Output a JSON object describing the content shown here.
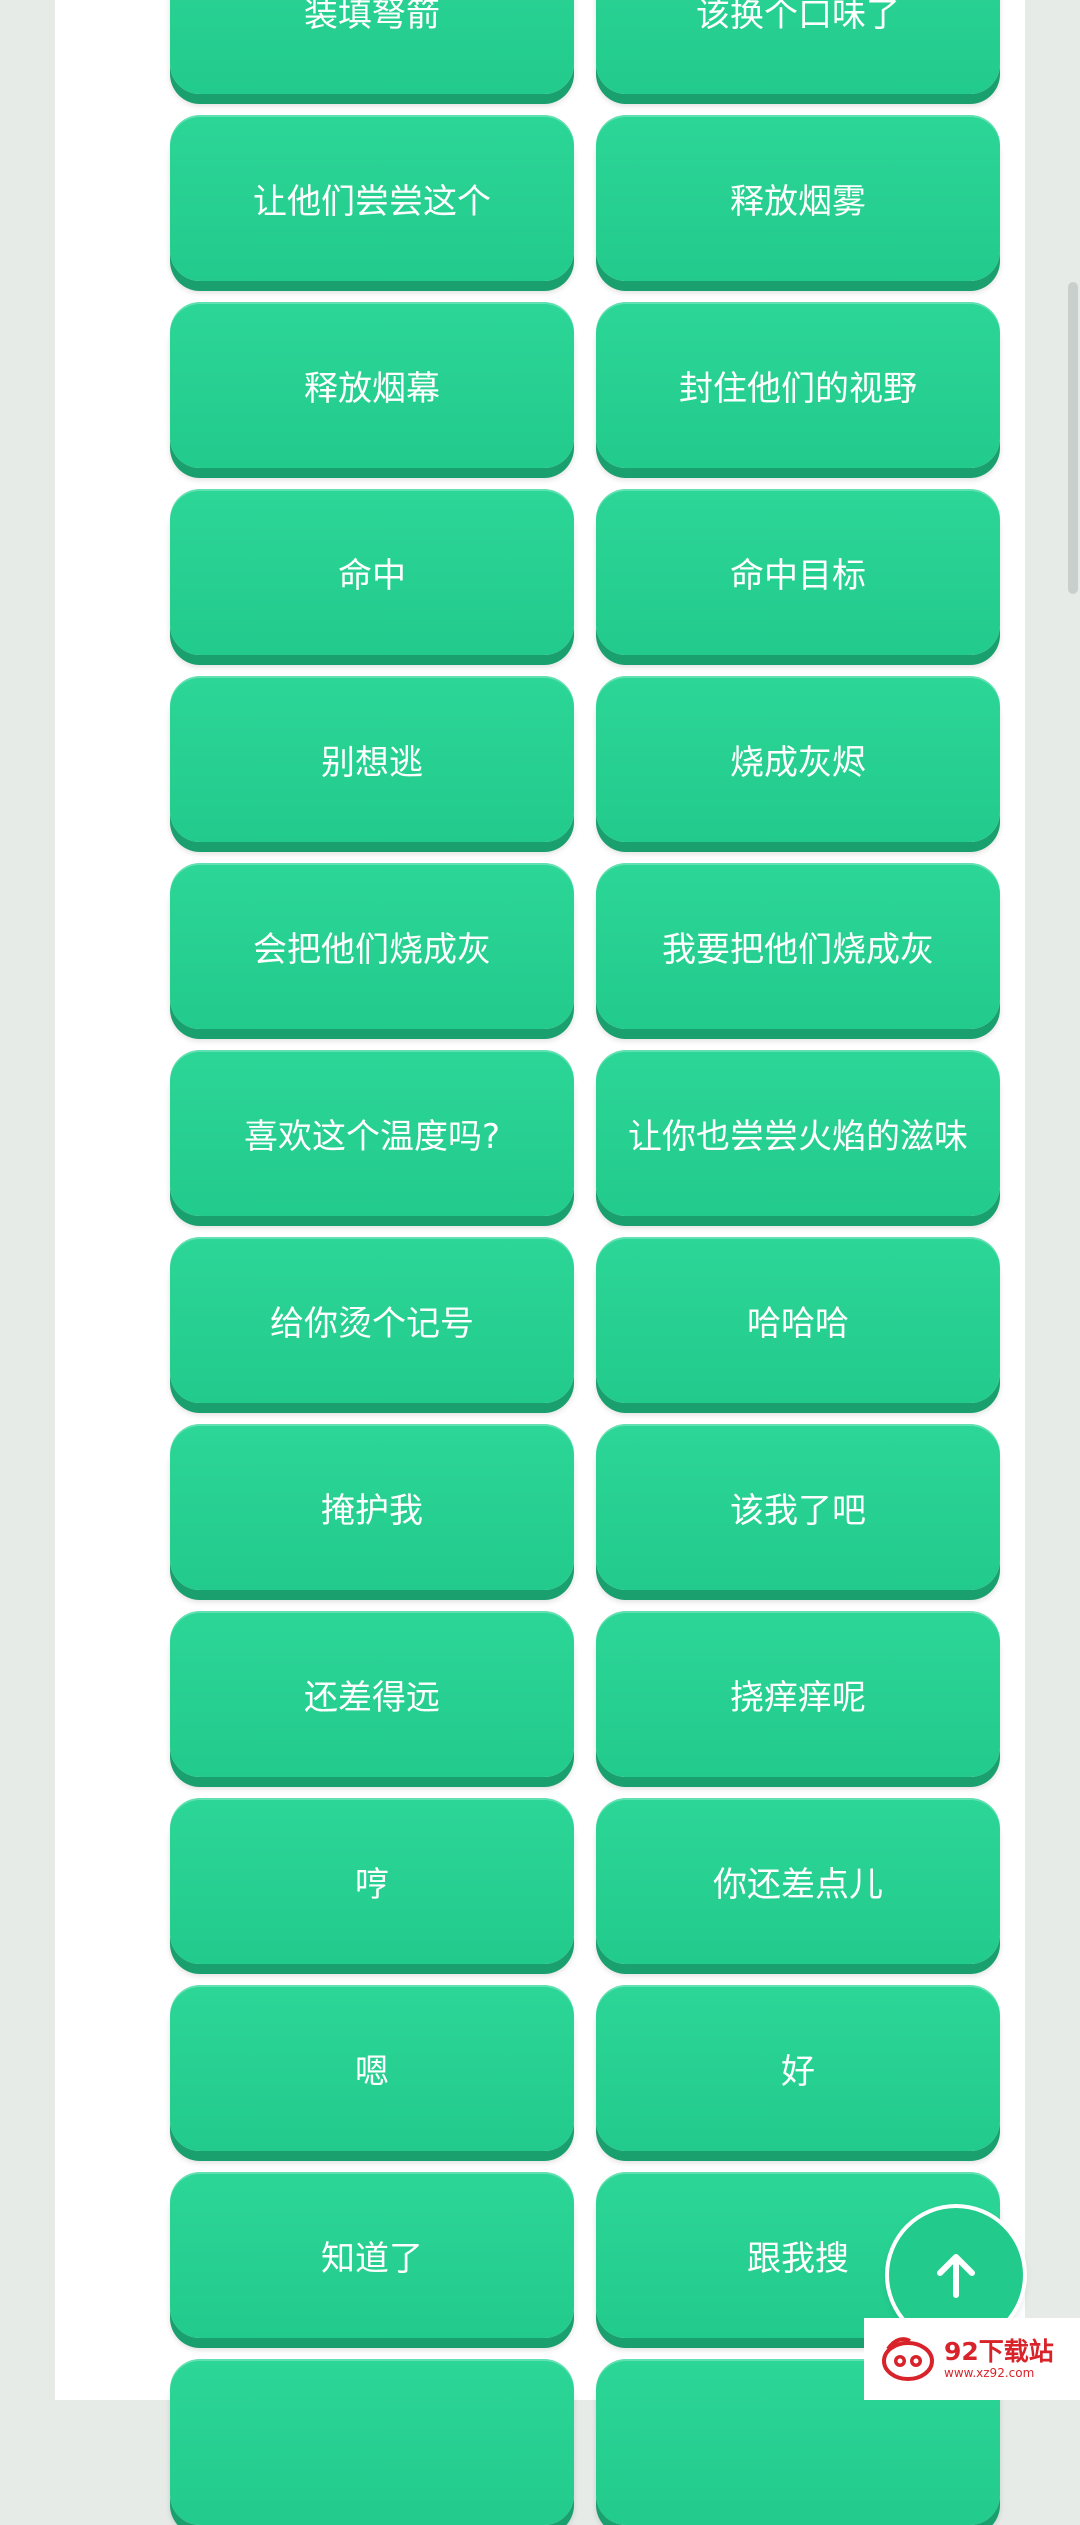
{
  "buttons": [
    "装填弩箭",
    "该换个口味了",
    "让他们尝尝这个",
    "释放烟雾",
    "释放烟幕",
    "封住他们的视野",
    "命中",
    "命中目标",
    "别想逃",
    "烧成灰烬",
    "会把他们烧成灰",
    "我要把他们烧成灰",
    "喜欢这个温度吗?",
    "让你也尝尝火焰的滋味",
    "给你烫个记号",
    "哈哈哈",
    "掩护我",
    "该我了吧",
    "还差得远",
    "挠痒痒呢",
    "哼",
    "你还差点儿",
    "嗯",
    "好",
    "知道了",
    "跟我搜",
    "",
    ""
  ],
  "watermark": {
    "name": "92下载站",
    "url": "www.xz92.com"
  },
  "colors": {
    "button": "#22cb8c",
    "button_shadow": "#1a9f6e",
    "logo_red": "#d8232a"
  },
  "icons": {
    "back_to_top": "arrow-up-icon"
  }
}
